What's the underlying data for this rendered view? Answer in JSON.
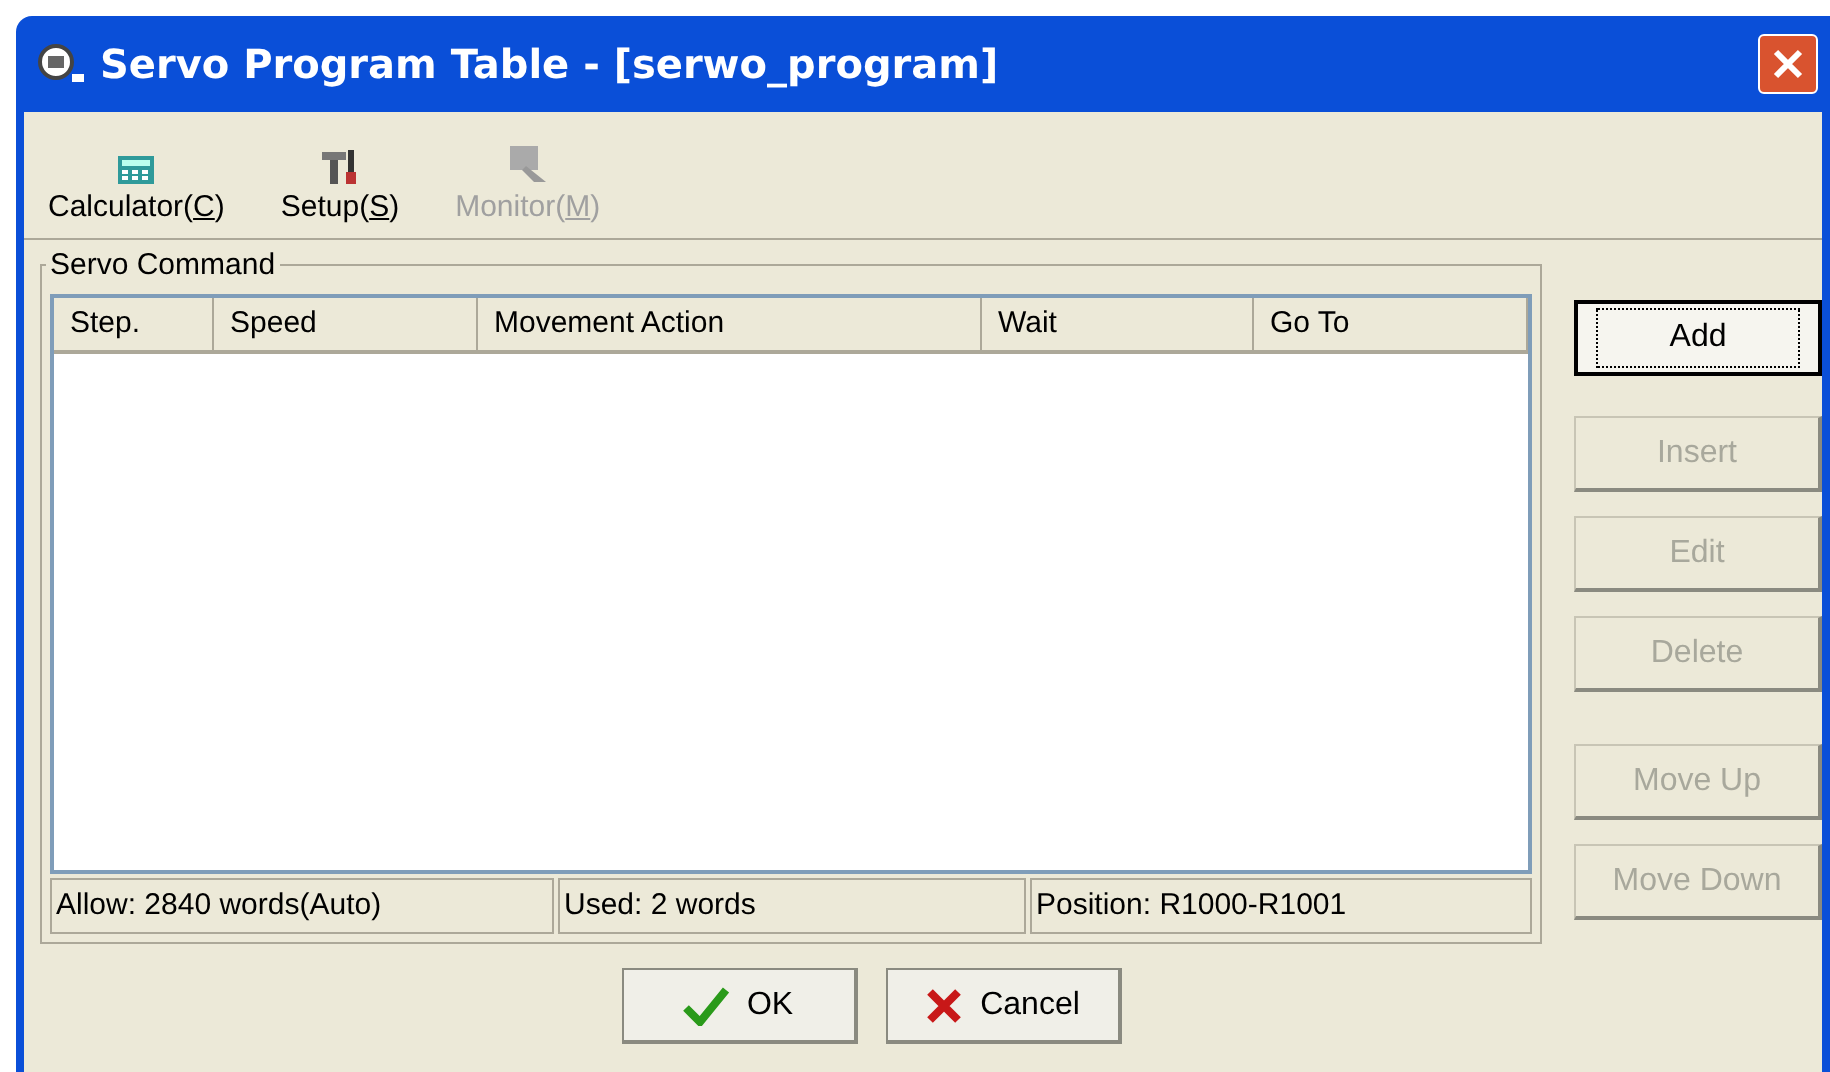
{
  "window": {
    "title": "Servo Program Table - [serwo_program]"
  },
  "toolbar": [
    {
      "label": "Calculator(C)",
      "kind": "calculator",
      "disabled": false
    },
    {
      "label": "Setup(S)",
      "kind": "setup",
      "disabled": false
    },
    {
      "label": "Monitor(M)",
      "kind": "monitor",
      "disabled": true
    }
  ],
  "group": {
    "title": "Servo Command"
  },
  "table": {
    "columns": [
      "Step.",
      "Speed",
      "Movement Action",
      "Wait",
      "Go To"
    ]
  },
  "status_bar": [
    "Allow: 2840 words(Auto)",
    "Used: 2 words",
    "Position: R1000-R1001"
  ],
  "side_buttons": [
    {
      "label": "Add",
      "disabled": false,
      "focused": true
    },
    {
      "label": "Insert",
      "disabled": true,
      "focused": false
    },
    {
      "label": "Edit",
      "disabled": true,
      "focused": false
    },
    {
      "label": "Delete",
      "disabled": true,
      "focused": false
    },
    {
      "label": "Move Up",
      "disabled": true,
      "focused": false
    },
    {
      "label": "Move Down",
      "disabled": true,
      "focused": false
    }
  ],
  "buttons": [
    {
      "label": "OK",
      "kind": "ok"
    },
    {
      "label": "Cancel",
      "kind": "cancel"
    }
  ]
}
